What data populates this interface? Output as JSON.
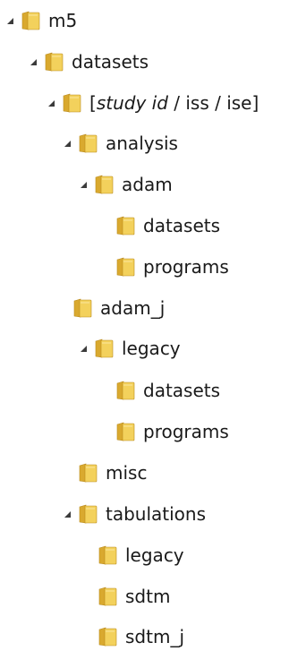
{
  "tree": {
    "items": [
      {
        "label": "m5",
        "expanded": true,
        "depth": 0
      },
      {
        "label": "datasets",
        "expanded": true,
        "depth": 1
      },
      {
        "label_parts": [
          "[",
          "study id",
          " / iss / ise]"
        ],
        "expanded": true,
        "depth": 2
      },
      {
        "label": "analysis",
        "expanded": true,
        "depth": 3
      },
      {
        "label": "adam",
        "expanded": true,
        "depth": 4
      },
      {
        "label": "datasets",
        "expanded": false,
        "depth": 5
      },
      {
        "label": "programs",
        "expanded": false,
        "depth": 5
      },
      {
        "label": "adam_j",
        "expanded": false,
        "depth": 4
      },
      {
        "label": "legacy",
        "expanded": true,
        "depth": 4
      },
      {
        "label": "datasets",
        "expanded": false,
        "depth": 5
      },
      {
        "label": "programs",
        "expanded": false,
        "depth": 5
      },
      {
        "label": "misc",
        "expanded": false,
        "depth": 4
      },
      {
        "label": "tabulations",
        "expanded": true,
        "depth": 3
      },
      {
        "label": "legacy",
        "expanded": false,
        "depth": 4
      },
      {
        "label": "sdtm",
        "expanded": false,
        "depth": 4
      },
      {
        "label": "sdtm_j",
        "expanded": false,
        "depth": 4
      }
    ]
  },
  "colors": {
    "folder_front": "#f3d15c",
    "folder_back": "#d9a92f",
    "folder_edge": "#b98a1c",
    "toggle": "#3b3b3b",
    "text": "#1a1a1a"
  },
  "icons": {
    "folder": "folder-icon",
    "expand": "expanded-triangle-icon"
  }
}
